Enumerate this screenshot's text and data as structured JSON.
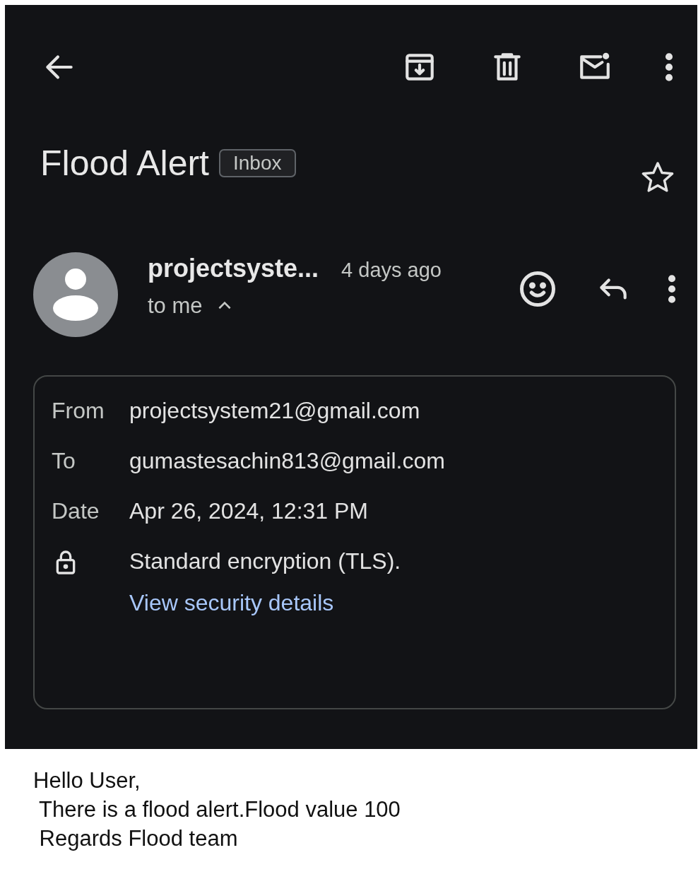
{
  "subject": {
    "title": "Flood Alert",
    "label": "Inbox",
    "starred": false
  },
  "message": {
    "sender": "projectsyste...",
    "time": "4 days ago",
    "recipient": "to me",
    "details_expanded": true
  },
  "details": [
    {
      "kind": "field",
      "label": "From",
      "value": "projectsystem21@gmail.com"
    },
    {
      "kind": "field",
      "label": "To",
      "value": "gumastesachin813@gmail.com"
    },
    {
      "kind": "field",
      "label": "Date",
      "value": "Apr 26, 2024, 12:31 PM"
    },
    {
      "kind": "security",
      "value": "Standard encryption (TLS).",
      "link": "View security details"
    }
  ],
  "body": [
    "Hello User,",
    " There is a flood alert.Flood value 100",
    " Regards Flood team"
  ]
}
